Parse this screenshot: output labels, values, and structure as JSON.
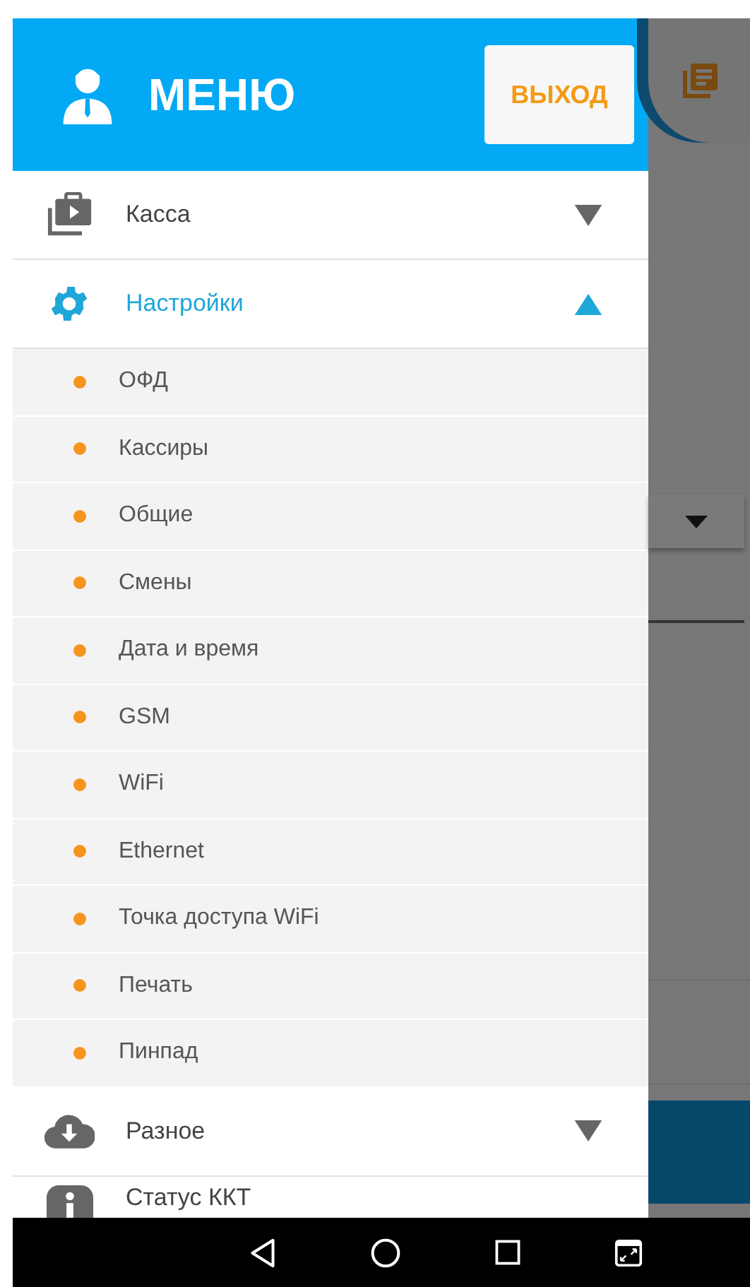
{
  "header": {
    "title": "МЕНЮ",
    "logout_button": "ВЫХОД"
  },
  "menu": [
    {
      "kind": "cash",
      "label": "Касса",
      "expanded": false
    },
    {
      "kind": "settings",
      "label": "Настройки",
      "expanded": true,
      "children": [
        {
          "label": "ОФД"
        },
        {
          "label": "Кассиры"
        },
        {
          "label": "Общие"
        },
        {
          "label": "Смены"
        },
        {
          "label": "Дата и время"
        },
        {
          "label": "GSM"
        },
        {
          "label": "WiFi"
        },
        {
          "label": "Ethernet"
        },
        {
          "label": "Точка доступа WiFi"
        },
        {
          "label": "Печать"
        },
        {
          "label": "Пинпад"
        }
      ]
    },
    {
      "kind": "misc",
      "label": "Разное",
      "expanded": false
    },
    {
      "kind": "info",
      "label": "Статус ККТ"
    }
  ]
}
